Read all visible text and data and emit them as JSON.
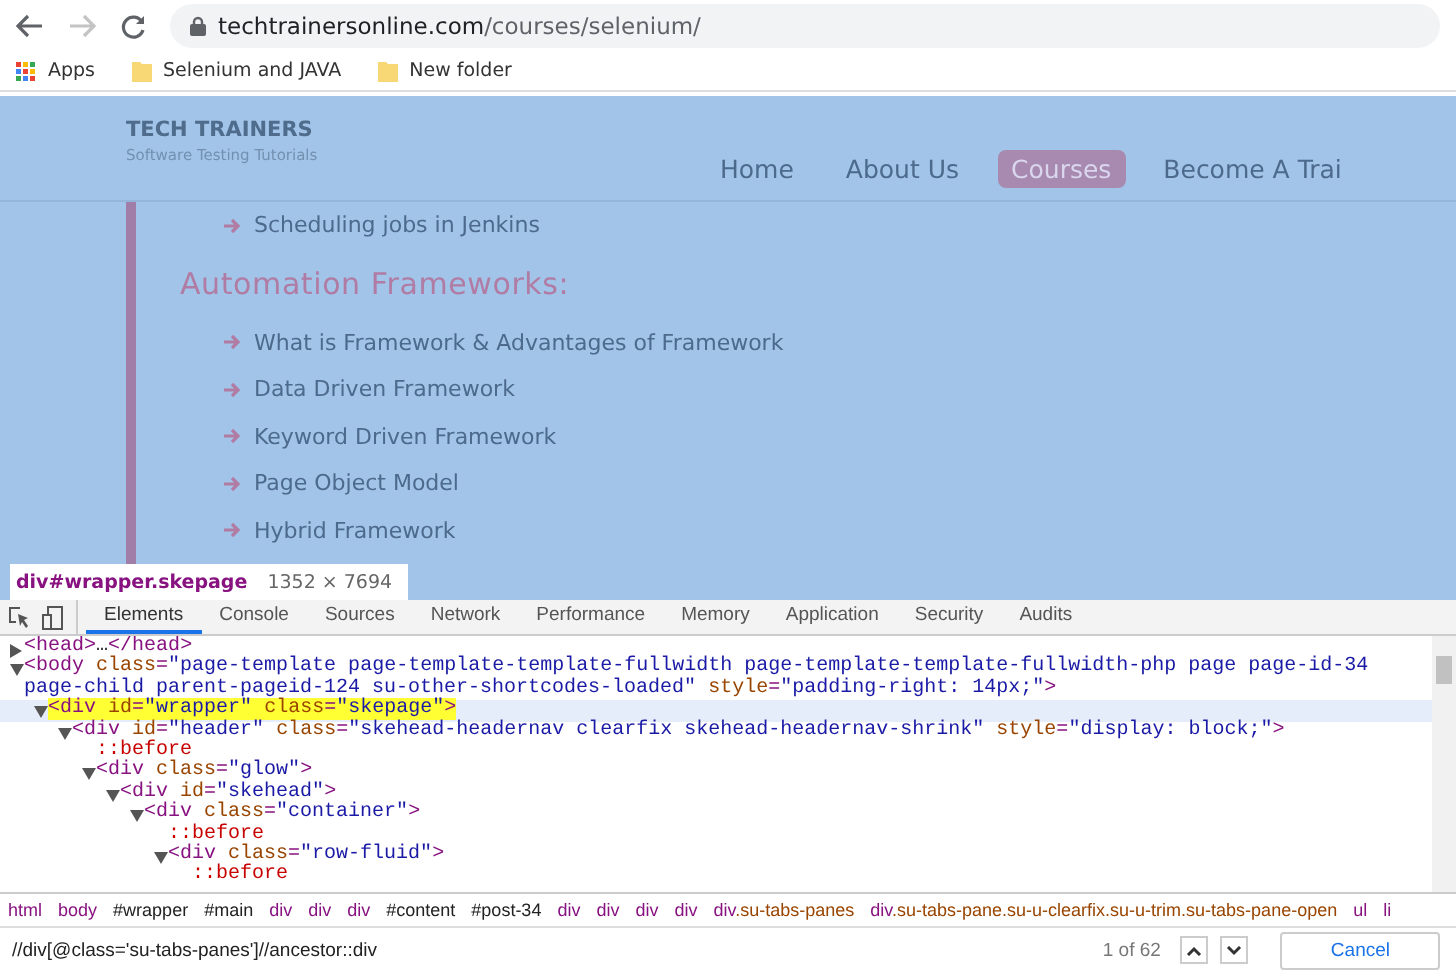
{
  "address_bar": {
    "domain": "techtrainersonline.com",
    "path": "/courses/selenium/",
    "back_disabled": false,
    "forward_disabled": true
  },
  "bookmarks": [
    {
      "label": "Apps",
      "kind": "apps"
    },
    {
      "label": "Selenium and JAVA",
      "kind": "folder"
    },
    {
      "label": "New folder",
      "kind": "folder"
    }
  ],
  "site": {
    "logo_title": "TECH TRAINERS",
    "logo_subtitle": "Software Testing Tutorials",
    "nav": [
      {
        "label": "Home",
        "selected": false
      },
      {
        "label": "About Us",
        "selected": false
      },
      {
        "label": "Courses",
        "selected": true
      },
      {
        "label": "Become A Trai",
        "selected": false
      }
    ],
    "items_above": [
      "Scheduling jobs in Jenkins"
    ],
    "heading": "Automation Frameworks:",
    "items": [
      "What is Framework & Advantages of Framework",
      "Data Driven Framework",
      "Keyword Driven Framework",
      "Page Object Model",
      "Hybrid Framework"
    ]
  },
  "inspect_tooltip": {
    "selector": "div#wrapper.skepage",
    "size": "1352 × 7694"
  },
  "devtools": {
    "tabs": [
      {
        "label": "Elements",
        "selected": true
      },
      {
        "label": "Console",
        "selected": false
      },
      {
        "label": "Sources",
        "selected": false
      },
      {
        "label": "Network",
        "selected": false
      },
      {
        "label": "Performance",
        "selected": false
      },
      {
        "label": "Memory",
        "selected": false
      },
      {
        "label": "Application",
        "selected": false
      },
      {
        "label": "Security",
        "selected": false
      },
      {
        "label": "Audits",
        "selected": false
      }
    ],
    "dom_tree": [
      {
        "text": "<head>…</head>",
        "expanded": false,
        "selected": false
      },
      {
        "text": "<body class=\"page-template page-template-template-fullwidth page-template-template-fullwidth-php page page-id-34 page-child parent-pageid-124 su-other-shortcodes-loaded\" style=\"padding-right: 14px;\">",
        "expanded": true,
        "selected": false,
        "children": [
          {
            "text": "<div id=\"wrapper\" class=\"skepage\">",
            "expanded": true,
            "selected": true,
            "children": [
              {
                "text": "<div id=\"header\" class=\"skehead-headernav clearfix skehead-headernav-shrink\" style=\"display: block;\">",
                "expanded": true,
                "selected": false,
                "children": [
                  {
                    "text": "::before",
                    "selected": false
                  },
                  {
                    "text": "<div class=\"glow\">",
                    "expanded": true,
                    "selected": false,
                    "children": [
                      {
                        "text": "<div id=\"skehead\">",
                        "expanded": true,
                        "selected": false,
                        "children": [
                          {
                            "text": "<div class=\"container\">",
                            "expanded": true,
                            "selected": false,
                            "children": [
                              {
                                "text": "::before",
                                "selected": false
                              },
                              {
                                "text": "<div class=\"row-fluid\">",
                                "expanded": true,
                                "selected": false,
                                "children": [
                                  {
                                    "text": "::before",
                                    "selected": false
                                  }
                                ]
                              }
                            ]
                          }
                        ]
                      }
                    ]
                  }
                ]
              }
            ]
          }
        ]
      }
    ],
    "breadcrumbs": [
      "html",
      "body",
      "#wrapper",
      "#main",
      "div",
      "div",
      "div",
      "#content",
      "#post-34",
      "div",
      "div",
      "div",
      "div",
      "div.su-tabs-panes",
      "div.su-tabs-pane.su-u-clearfix.su-u-trim.su-tabs-pane-open",
      "ul",
      "li"
    ],
    "search": {
      "value": "//div[@class='su-tabs-panes']//ancestor::div",
      "match_count": "1 of 62",
      "cancel": "Cancel"
    }
  }
}
